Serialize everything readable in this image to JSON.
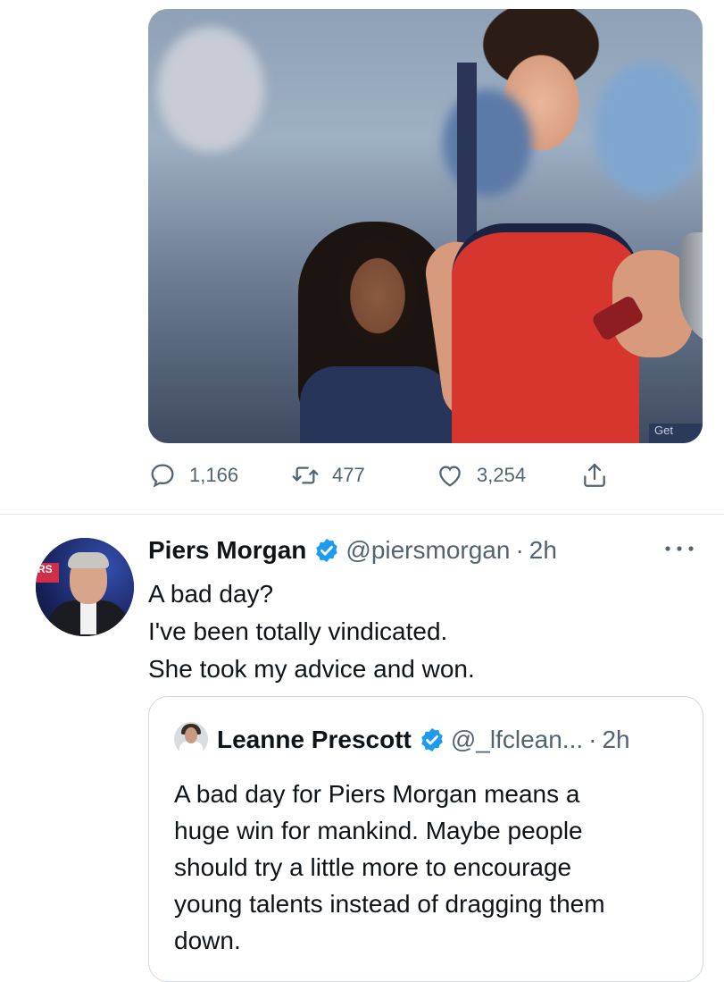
{
  "first_tweet": {
    "media": {
      "description_icon": "photo",
      "corner_tag": "Get"
    },
    "actions": {
      "reply_count": "1,166",
      "retweet_count": "477",
      "like_count": "3,254"
    }
  },
  "tweet": {
    "author_name": "Piers Morgan",
    "handle": "@piersmorgan",
    "separator": "·",
    "time": "2h",
    "avatar_badge": "RS",
    "lines": [
      "A bad day?",
      "I've been totally vindicated.",
      "She took my advice and won."
    ]
  },
  "quoted": {
    "author_name": "Leanne Prescott",
    "handle": "@_lfclean...",
    "separator": "·",
    "time": "2h",
    "lines": [
      "A bad day for Piers Morgan means a",
      "huge win for mankind. Maybe people",
      "should try a little more to encourage",
      "young talents instead of dragging them",
      "down."
    ]
  },
  "colors": {
    "text": "#0f1419",
    "muted": "#536471",
    "verified": "#1d9bf0",
    "border": "#cfd9de"
  },
  "icons": {
    "reply": "reply-icon",
    "retweet": "retweet-icon",
    "like": "heart-icon",
    "share": "share-icon",
    "verified": "verified-badge-icon",
    "more": "more-options-icon"
  }
}
